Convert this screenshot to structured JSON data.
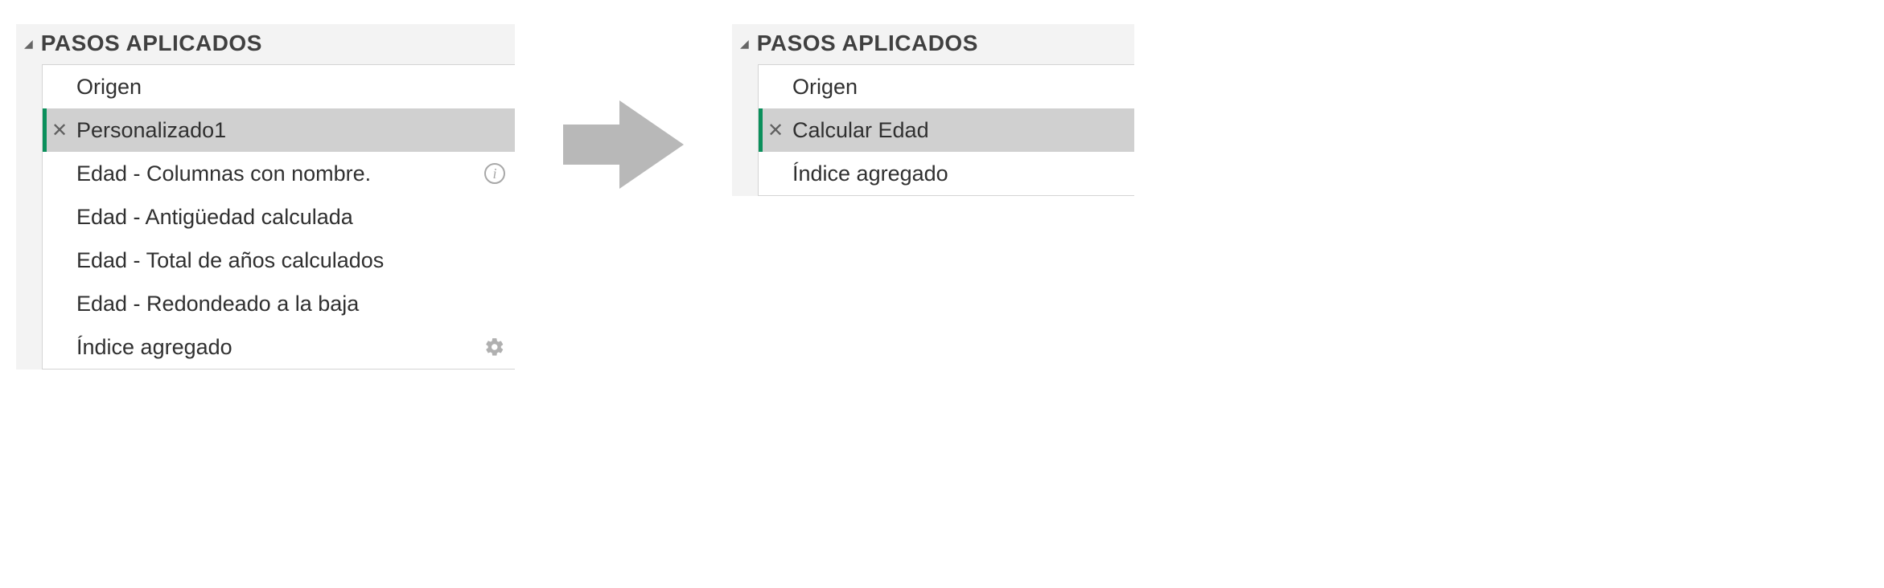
{
  "panel_title": "PASOS APLICADOS",
  "left_steps": [
    {
      "label": "Origen",
      "selected": false,
      "info": false,
      "gear": false
    },
    {
      "label": "Personalizado1",
      "selected": true,
      "info": false,
      "gear": false
    },
    {
      "label": "Edad - Columnas con nombre.",
      "selected": false,
      "info": true,
      "gear": false
    },
    {
      "label": "Edad - Antigüedad calculada",
      "selected": false,
      "info": false,
      "gear": false
    },
    {
      "label": "Edad - Total de años calculados",
      "selected": false,
      "info": false,
      "gear": false
    },
    {
      "label": "Edad - Redondeado a la baja",
      "selected": false,
      "info": false,
      "gear": false
    },
    {
      "label": "Índice agregado",
      "selected": false,
      "info": false,
      "gear": true
    }
  ],
  "right_steps": [
    {
      "label": "Origen",
      "selected": false
    },
    {
      "label": "Calcular Edad",
      "selected": true
    },
    {
      "label": "Índice agregado",
      "selected": false
    }
  ]
}
